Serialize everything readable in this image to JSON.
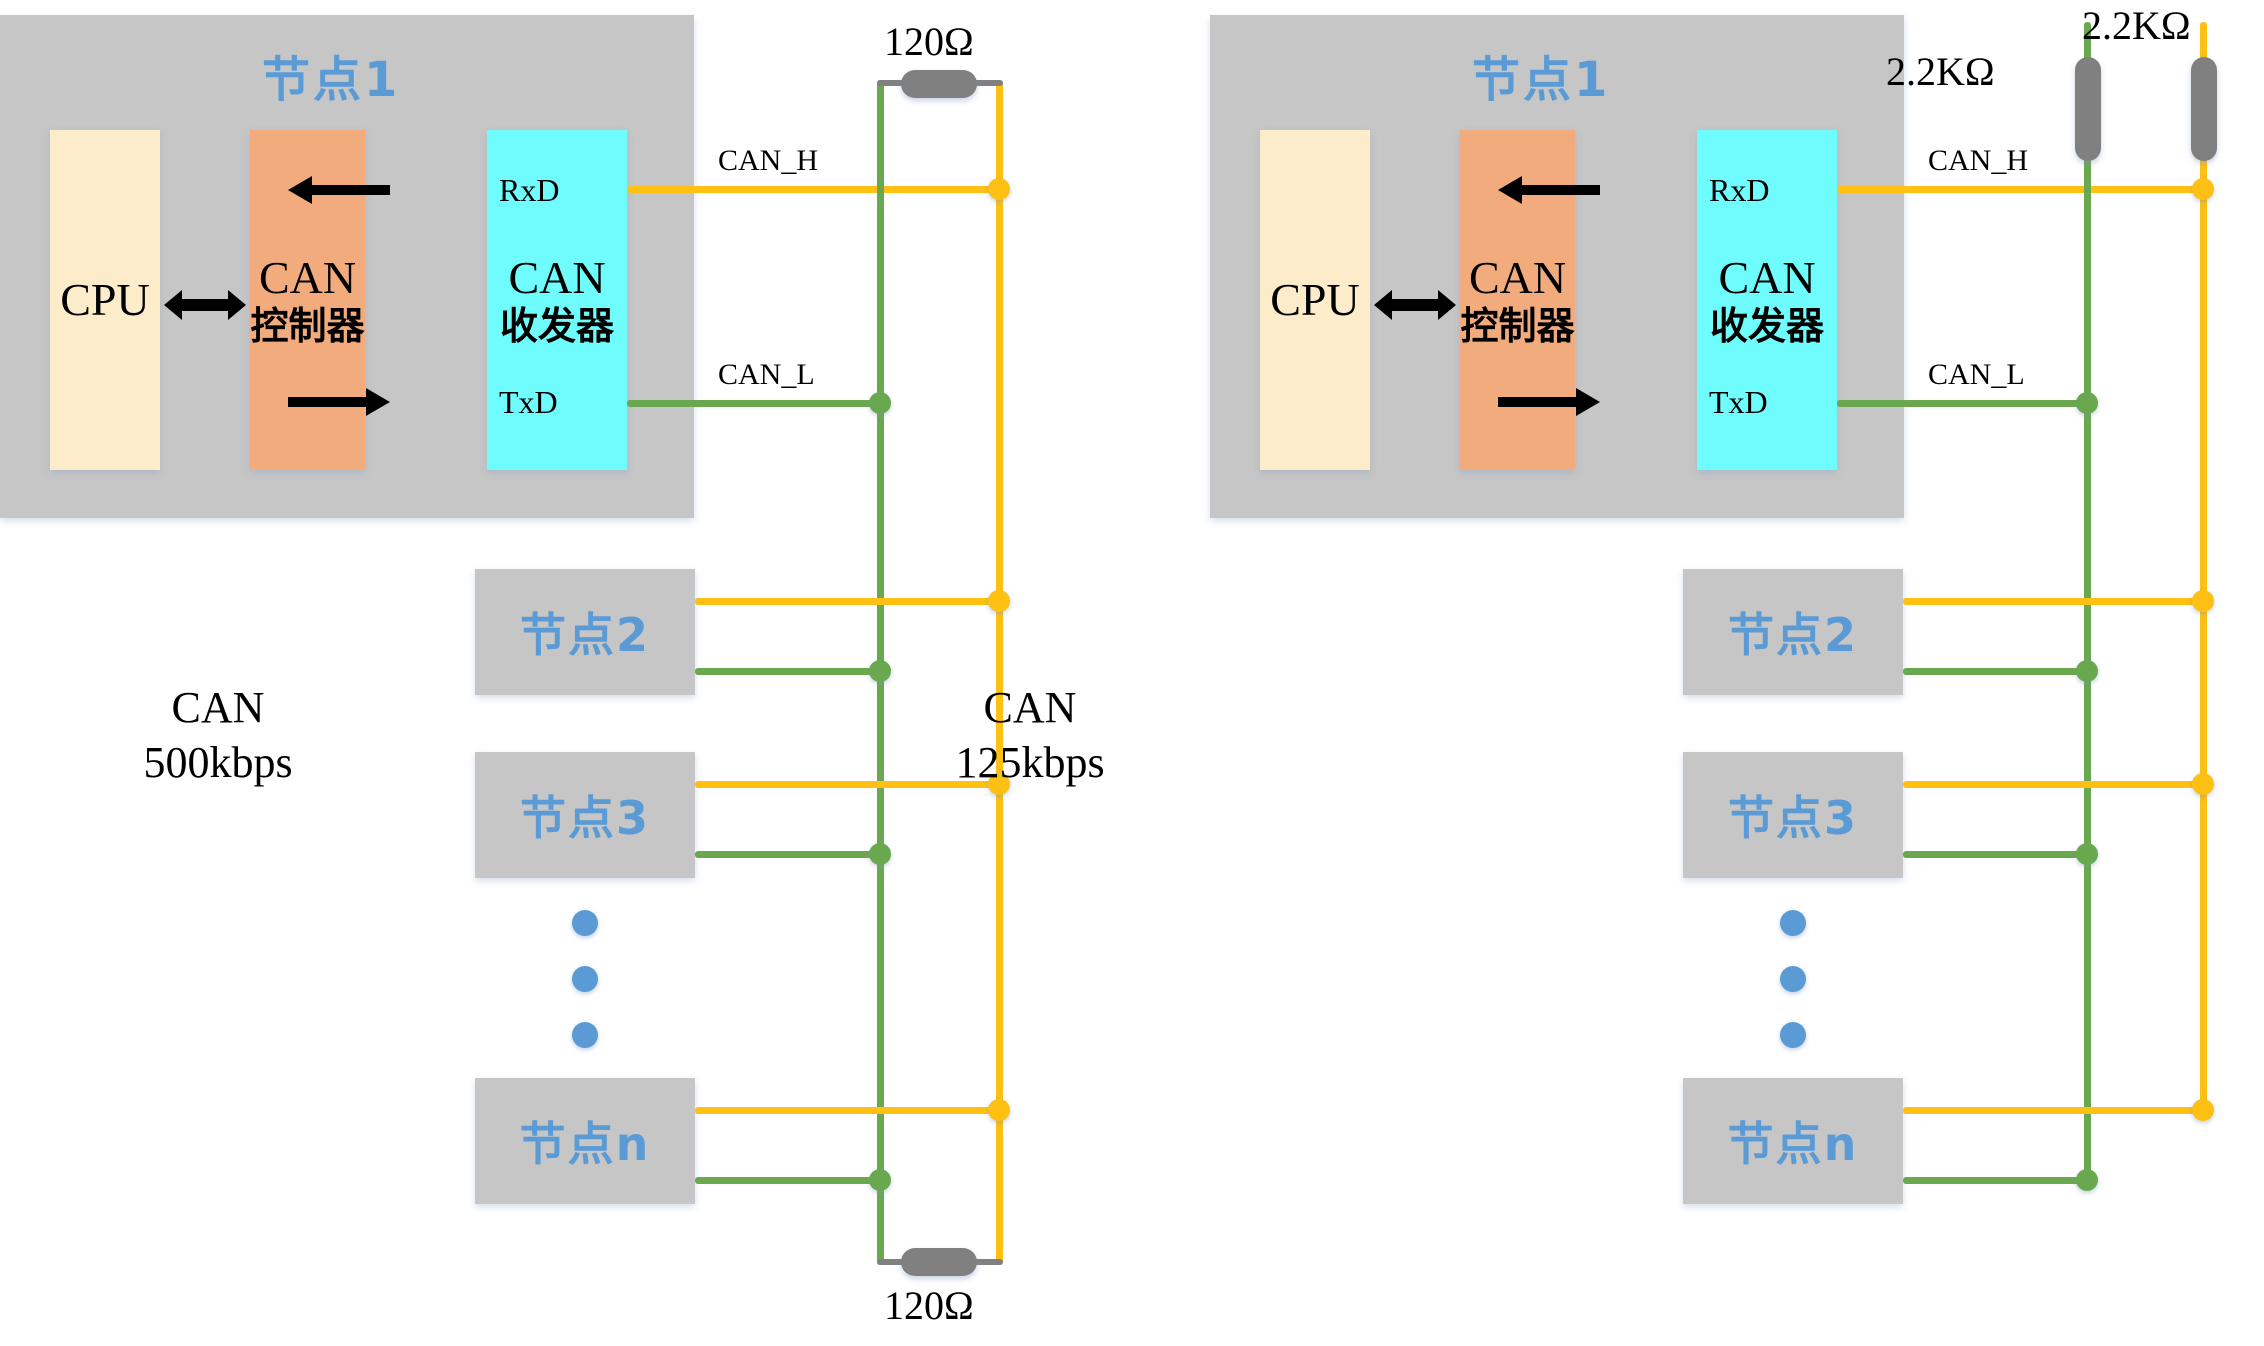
{
  "diagram": {
    "title_semantic": "CAN bus network topology comparison",
    "colors": {
      "can_h_wire": "#fdc013",
      "can_l_wire": "#6aa84f",
      "panel_gray": "#c6c6c6",
      "cpu_block": "#fcecc9",
      "controller_block": "#f2ab7c",
      "transceiver_block": "#6ffcfc",
      "node_label_blue": "#5b9bd5",
      "resistor_gray": "#808080"
    }
  },
  "left": {
    "node1": {
      "title": "节点1",
      "cpu_label": "CPU",
      "controller_line1": "CAN",
      "controller_line2": "控制器",
      "transceiver_line1": "CAN",
      "transceiver_line2": "收发器",
      "rxd_pin": "RxD",
      "txd_pin": "TxD"
    },
    "bus_labels": {
      "can_h": "CAN_H",
      "can_l": "CAN_L"
    },
    "rate_label": "CAN\n500kbps",
    "rate_line1": "CAN",
    "rate_line2": "500kbps",
    "terminator_top": "120Ω",
    "terminator_bottom": "120Ω",
    "nodes": [
      "节点2",
      "节点3",
      "节点n"
    ],
    "ellipsis": "⋮"
  },
  "right": {
    "node1": {
      "title": "节点1",
      "cpu_label": "CPU",
      "controller_line1": "CAN",
      "controller_line2": "控制器",
      "transceiver_line1": "CAN",
      "transceiver_line2": "收发器",
      "rxd_pin": "RxD",
      "txd_pin": "TxD"
    },
    "bus_labels": {
      "can_h": "CAN_H",
      "can_l": "CAN_L"
    },
    "rate_line1": "CAN",
    "rate_line2": "125kbps",
    "pullup_can_l": "2.2KΩ",
    "pullup_can_h": "2.2KΩ",
    "nodes": [
      "节点2",
      "节点3",
      "节点n"
    ],
    "ellipsis": "⋮"
  }
}
